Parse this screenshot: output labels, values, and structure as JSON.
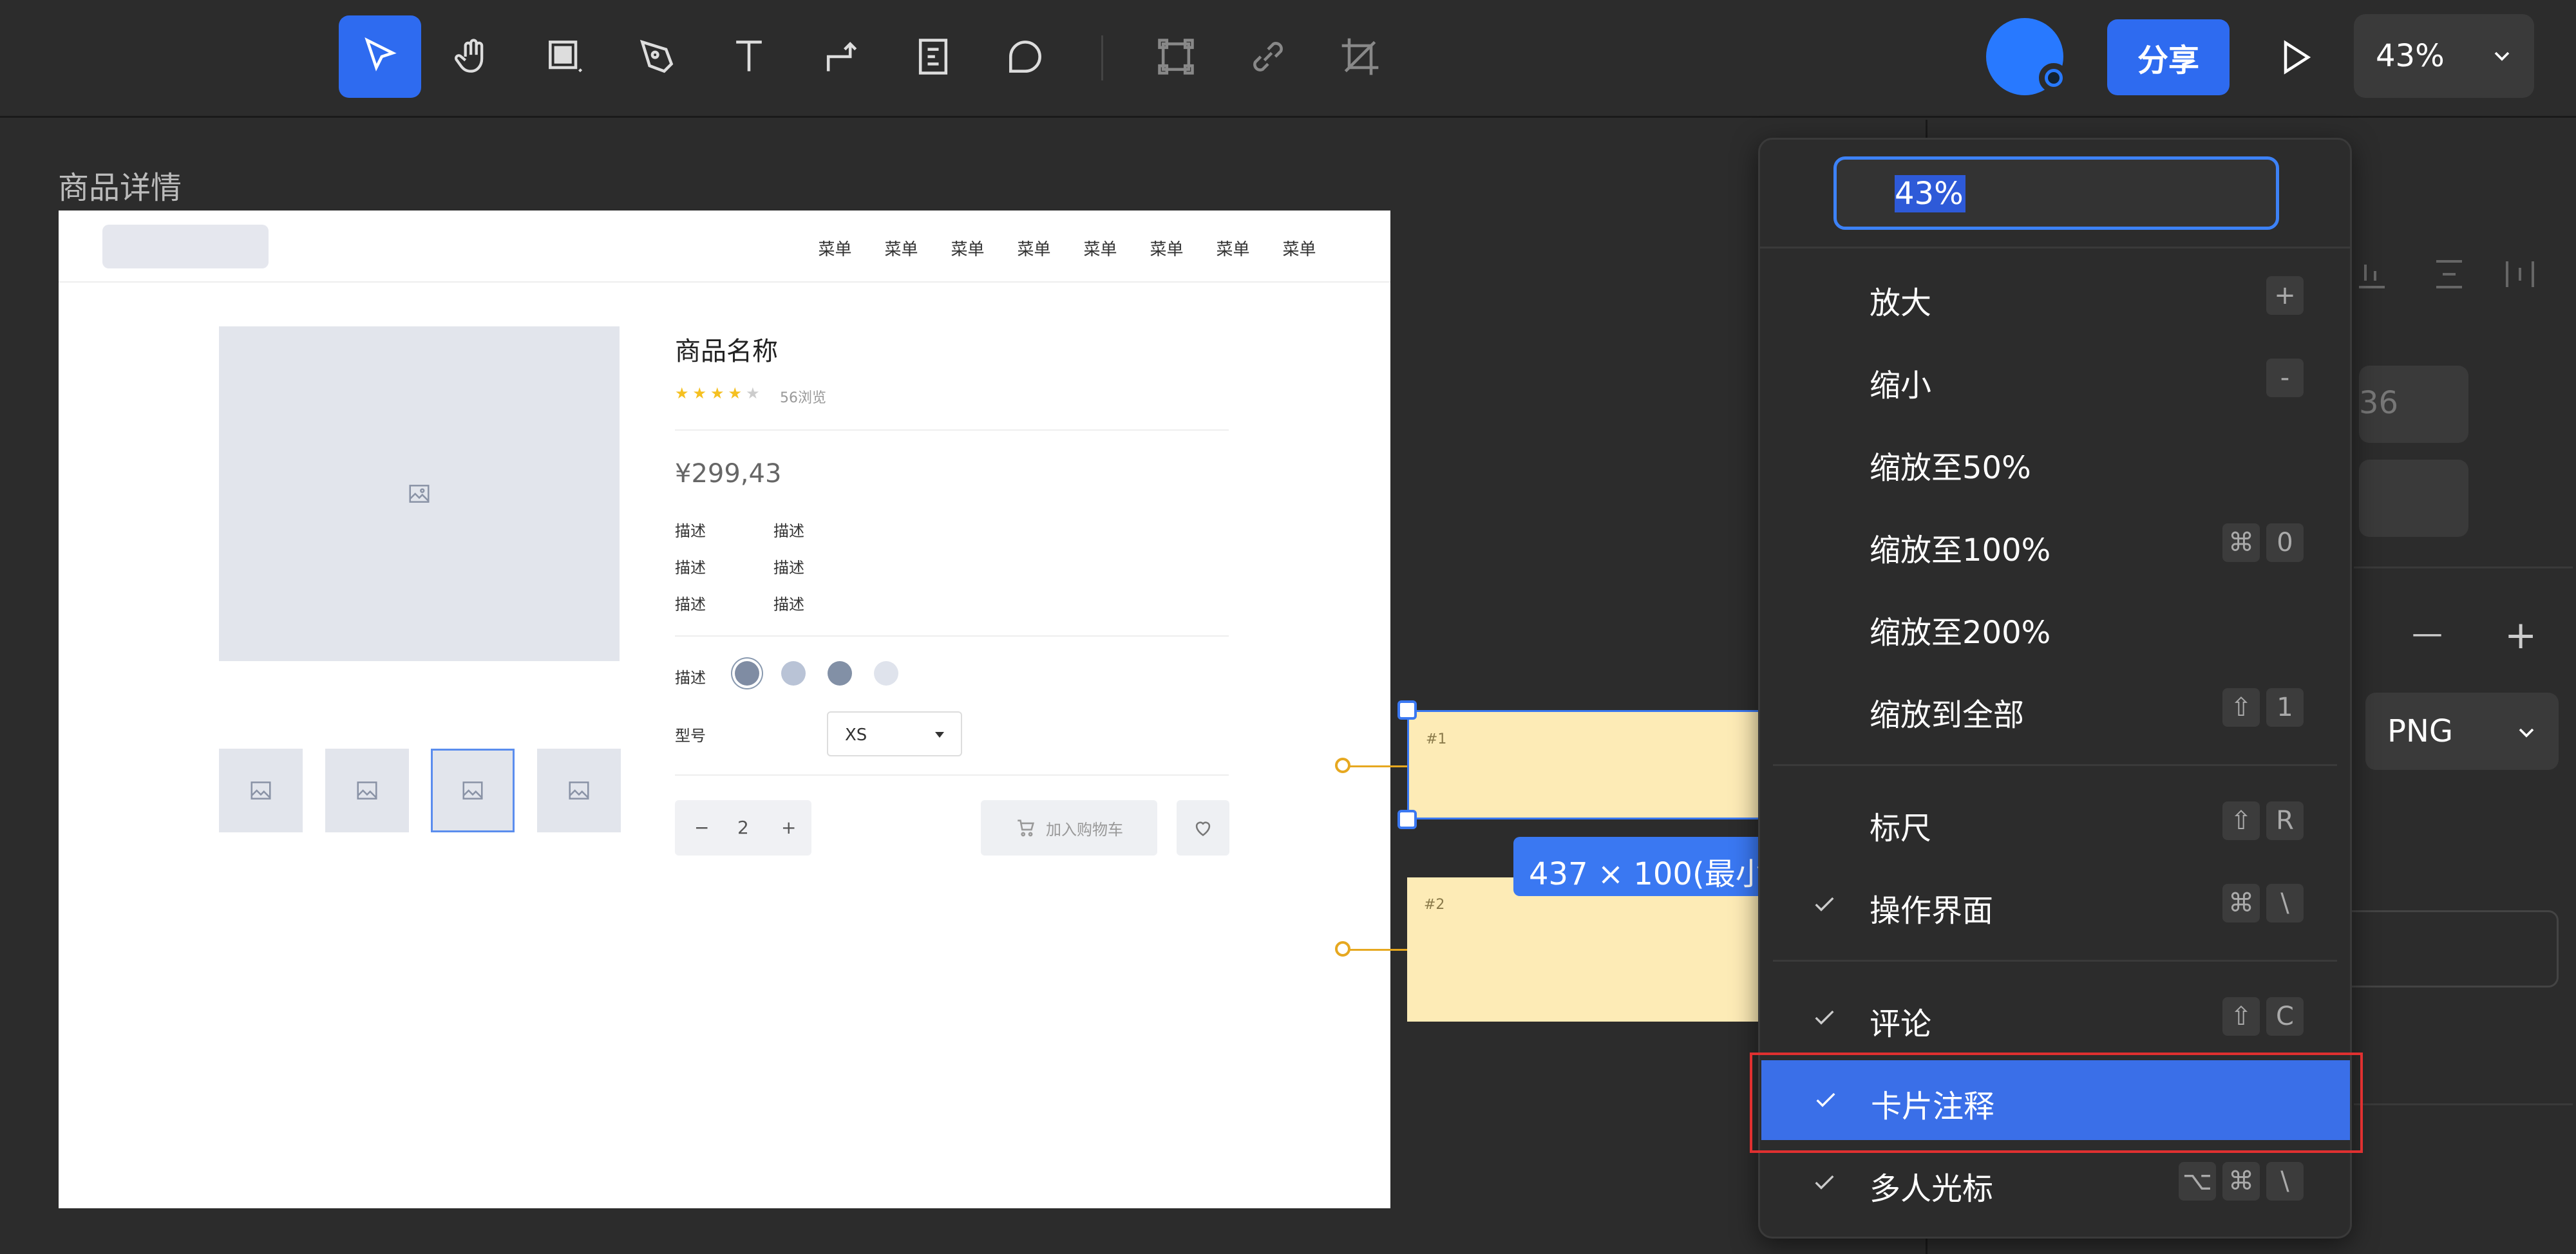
{
  "toolbar": {
    "tools": [
      "select-tool",
      "hand-tool",
      "frame-tool",
      "pen-tool",
      "text-tool",
      "connector-tool",
      "note-tool",
      "shape-tool",
      "component-tool",
      "link-tool",
      "crop-tool"
    ],
    "share_label": "分享",
    "zoom_value": "43%"
  },
  "canvas": {
    "frame_label": "商品详情",
    "nav_items": [
      "菜单",
      "菜单",
      "菜单",
      "菜单",
      "菜单",
      "菜单",
      "菜单",
      "菜单"
    ],
    "product_name": "商品名称",
    "rating": 4,
    "rating_max": 5,
    "views": "56浏览",
    "price": "¥299,43",
    "desc_rows": [
      [
        "描述",
        "描述"
      ],
      [
        "描述",
        "描述"
      ],
      [
        "描述",
        "描述"
      ]
    ],
    "color_label": "描述",
    "colors": [
      "#7f8ca3",
      "#b9c3d6",
      "#8290a6",
      "#dfe3ec"
    ],
    "model_label": "型号",
    "model_value": "XS",
    "qty_minus": "−",
    "qty_value": "2",
    "qty_plus": "+",
    "add_cart": "加入购物车"
  },
  "annotations": {
    "card1_tag": "#1",
    "card2_tag": "#2",
    "dimension_label": "437 × 100(最小"
  },
  "right_panel": {
    "value_partial": "36",
    "minus": "—",
    "plus": "+",
    "export_format": "PNG"
  },
  "zoom_menu": {
    "input_value": "43%",
    "items": [
      {
        "label": "放大",
        "keys": [
          "+"
        ],
        "checked": false
      },
      {
        "label": "缩小",
        "keys": [
          "-"
        ],
        "checked": false
      },
      {
        "label": "缩放至50%",
        "keys": [],
        "checked": false
      },
      {
        "label": "缩放至100%",
        "keys": [
          "⌘",
          "0"
        ],
        "checked": false
      },
      {
        "label": "缩放至200%",
        "keys": [],
        "checked": false
      },
      {
        "label": "缩放到全部",
        "keys": [
          "⇧",
          "1"
        ],
        "checked": false
      },
      {
        "label": "标尺",
        "keys": [
          "⇧",
          "R"
        ],
        "checked": false
      },
      {
        "label": "操作界面",
        "keys": [
          "⌘",
          "\\"
        ],
        "checked": true
      },
      {
        "label": "评论",
        "keys": [
          "⇧",
          "C"
        ],
        "checked": true
      },
      {
        "label": "卡片注释",
        "keys": [],
        "checked": true
      },
      {
        "label": "多人光标",
        "keys": [
          "⌥",
          "⌘",
          "\\"
        ],
        "checked": true
      }
    ]
  },
  "colors": {
    "accent": "#2e6bf0",
    "menu_bg": "#2c2c2c",
    "highlight": "#e03030",
    "card_bg": "#fdebb6"
  }
}
